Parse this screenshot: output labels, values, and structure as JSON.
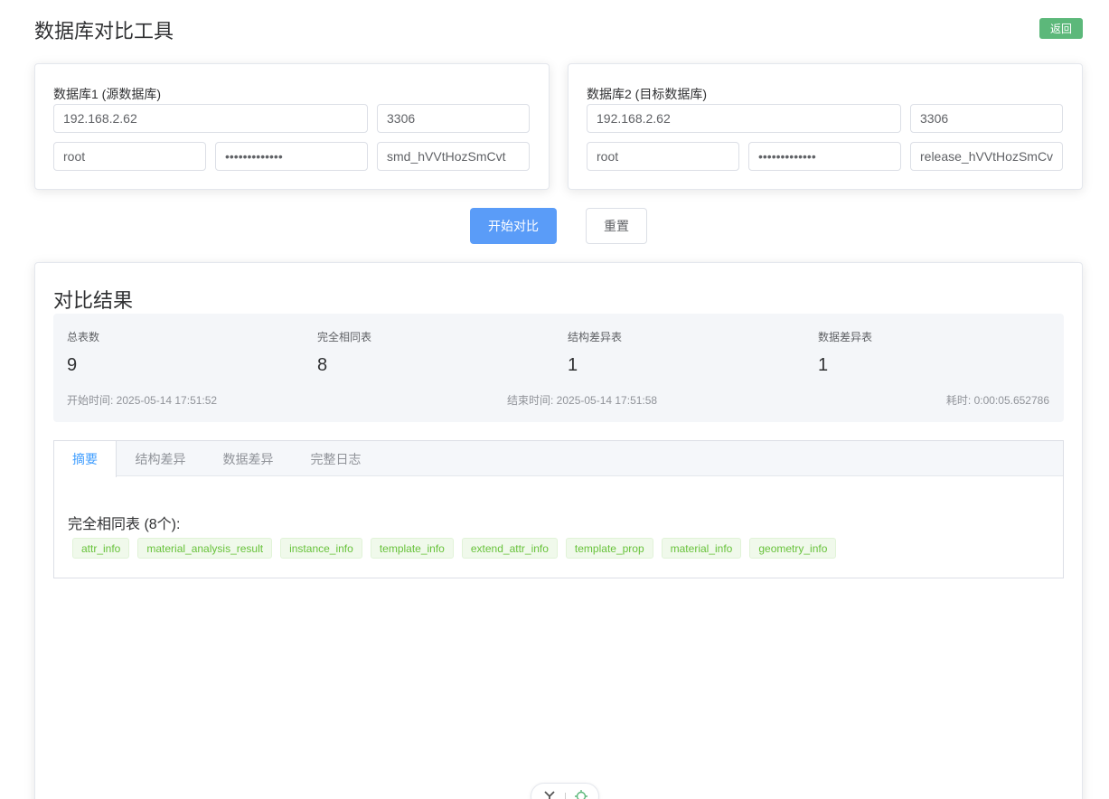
{
  "header": {
    "title": "数据库对比工具",
    "back_label": "返回"
  },
  "db1": {
    "title": "数据库1 (源数据库)",
    "host": "192.168.2.62",
    "port": "3306",
    "user": "root",
    "password": "•••••••••••••",
    "database": "smd_hVVtHozSmCvt"
  },
  "db2": {
    "title": "数据库2 (目标数据库)",
    "host": "192.168.2.62",
    "port": "3306",
    "user": "root",
    "password": "•••••••••••••",
    "database": "release_hVVtHozSmCv"
  },
  "actions": {
    "compare_label": "开始对比",
    "reset_label": "重置"
  },
  "result": {
    "title": "对比结果",
    "stats": [
      {
        "label": "总表数",
        "value": "9"
      },
      {
        "label": "完全相同表",
        "value": "8"
      },
      {
        "label": "结构差异表",
        "value": "1"
      },
      {
        "label": "数据差异表",
        "value": "1"
      }
    ],
    "start_time": "开始时间: 2025-05-14 17:51:52",
    "end_time": "结束时间: 2025-05-14 17:51:58",
    "elapsed": "耗时: 0:00:05.652786",
    "tabs": [
      {
        "label": "摘要",
        "active": true
      },
      {
        "label": "结构差异",
        "active": false
      },
      {
        "label": "数据差异",
        "active": false
      },
      {
        "label": "完整日志",
        "active": false
      }
    ],
    "identical_title": "完全相同表 (8个):",
    "identical_tables": [
      "attr_info",
      "material_analysis_result",
      "instance_info",
      "template_info",
      "extend_attr_info",
      "template_prop",
      "material_info",
      "geometry_info"
    ]
  },
  "floating_toolbar": {
    "icon_left": "translate-icon",
    "icon_right": "target-icon"
  },
  "colors": {
    "primary": "#5a9cf8",
    "success": "#5cb87a",
    "tag_text": "#67c23a",
    "tab_active": "#409eff"
  }
}
